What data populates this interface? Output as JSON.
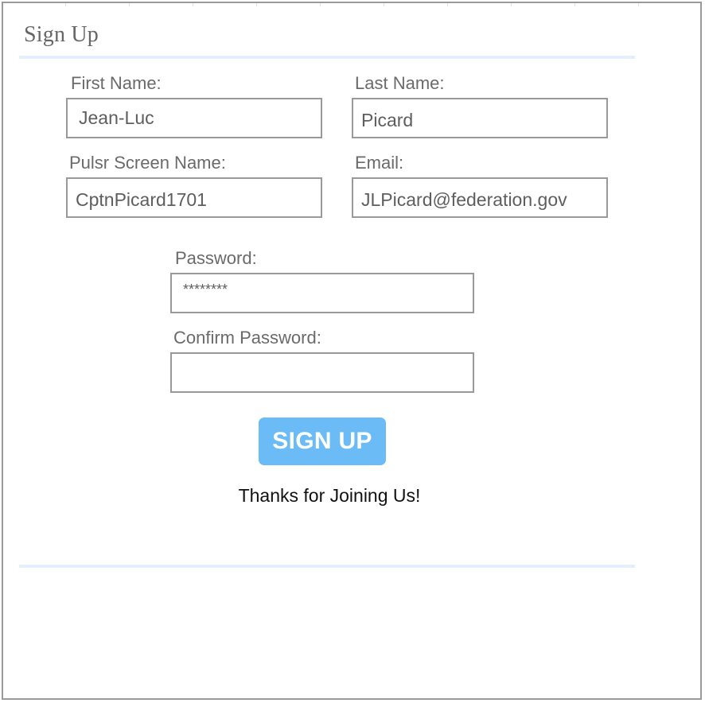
{
  "form": {
    "title": "Sign Up",
    "fields": {
      "first_name": {
        "label": "First Name:",
        "value": "Jean-Luc"
      },
      "last_name": {
        "label": "Last Name:",
        "value": "Picard"
      },
      "screen_name": {
        "label": "Pulsr Screen Name:",
        "value": "CptnPicard1701"
      },
      "email": {
        "label": "Email:",
        "value": "JLPicard@federation.gov"
      },
      "password": {
        "label": "Password:",
        "value": "********"
      },
      "confirm_password": {
        "label": "Confirm Password:",
        "value": ""
      }
    },
    "submit_label": "SIGN UP",
    "thanks_message": "Thanks for Joining Us!"
  },
  "colors": {
    "button_bg": "#6bbcf6",
    "divider": "#e3f0fb",
    "border": "#999999"
  }
}
